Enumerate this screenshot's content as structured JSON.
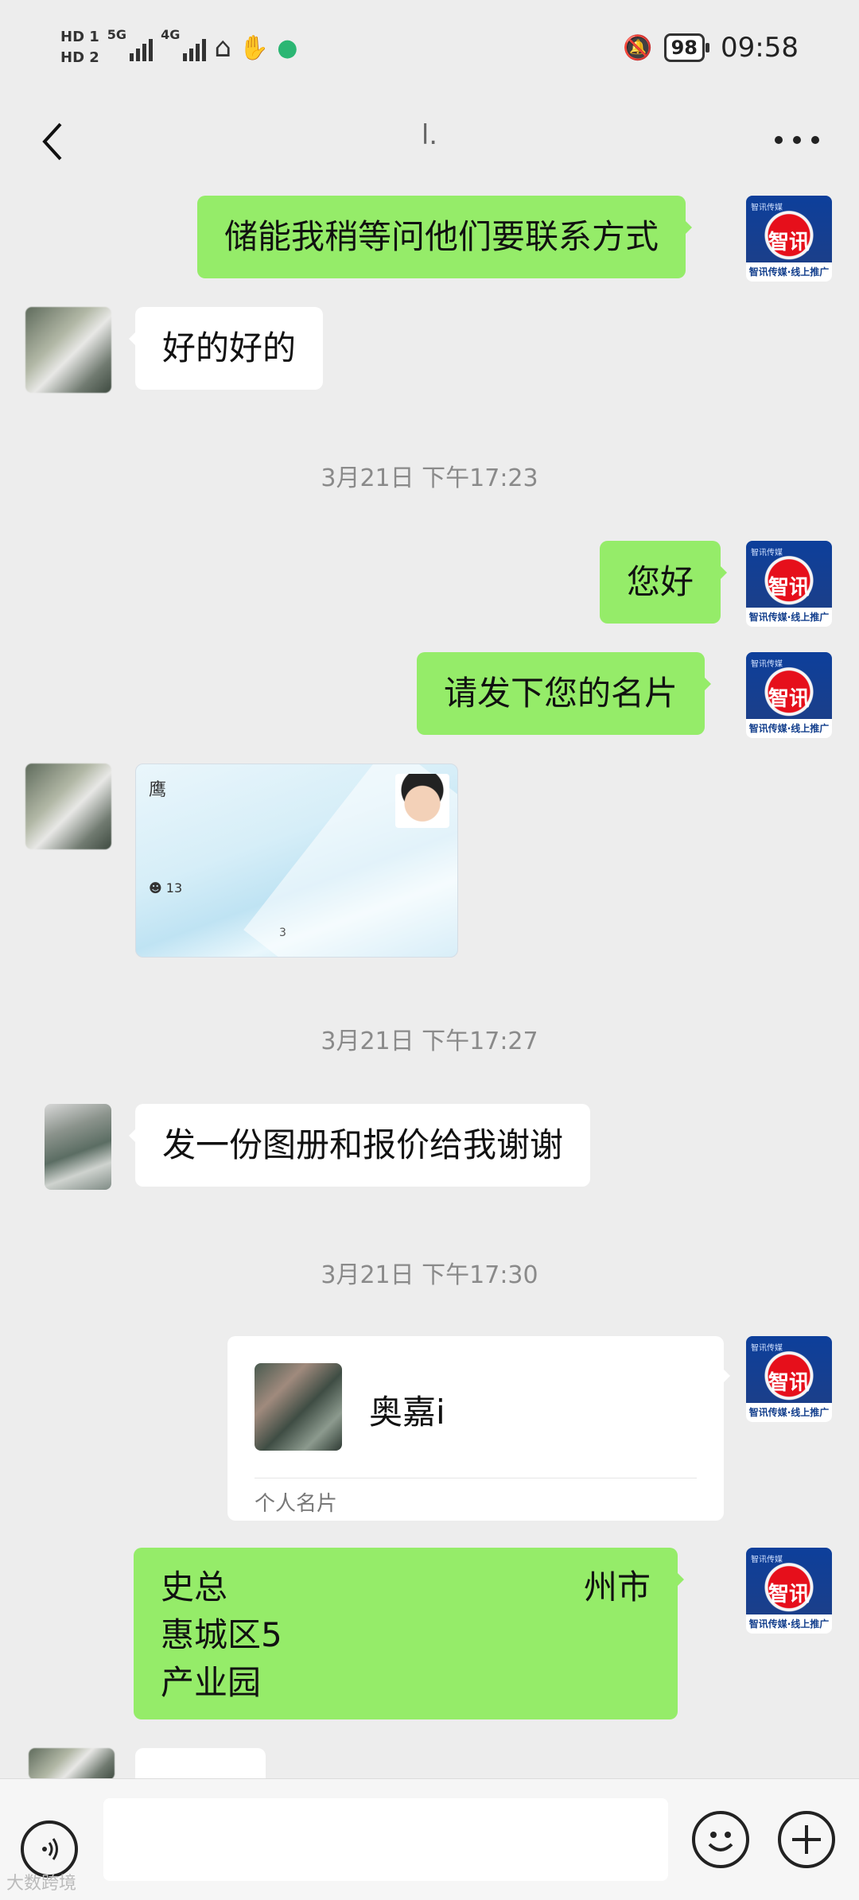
{
  "status_bar": {
    "hd1": "HD 1",
    "hd2": "HD 2",
    "net1": "5G",
    "net2": "4G",
    "battery": "98",
    "time": "09:58"
  },
  "header": {
    "title": "l.",
    "back_icon": "chevron-left-icon",
    "more_icon": "more-dots-icon"
  },
  "avatar_me": {
    "brand": "智讯",
    "top": "智讯传媒",
    "tag": "智讯传媒·线上推广"
  },
  "messages": [
    {
      "side": "me",
      "text": "储能我稍等问他们要联系方式"
    },
    {
      "side": "other",
      "text": "好的好的"
    },
    {
      "side": "me",
      "text": "您好"
    },
    {
      "side": "me",
      "text": "请发下您的名片"
    },
    {
      "side": "other",
      "text": "发一份图册和报价给我谢谢"
    }
  ],
  "timestamps": [
    "3月21日 下午17:23",
    "3月21日 下午17:27",
    "3月21日 下午17:30"
  ],
  "business_card_image": {
    "t1": "鹰",
    "t2": "☻ 13",
    "t3": "3"
  },
  "contact_card": {
    "name": "奥嘉i",
    "type": "个人名片"
  },
  "address_message": {
    "line1": "史总",
    "line1_right": "州市",
    "line2": "惠城区5",
    "line3": "产业园"
  },
  "input_bar": {
    "voice_icon": "voice-icon",
    "emoji_icon": "emoji-icon",
    "plus_icon": "plus-icon"
  },
  "watermark": "大数跨境"
}
